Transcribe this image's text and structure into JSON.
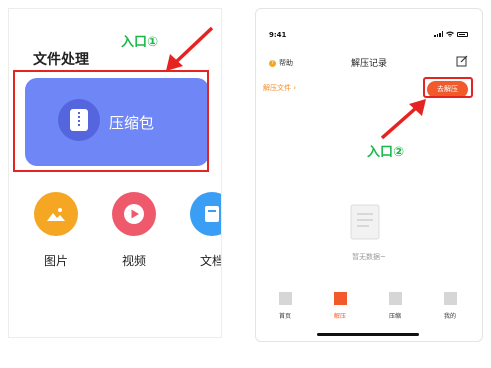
{
  "left": {
    "section_title": "文件处理",
    "annotation": "入口①",
    "compress_label": "压缩包",
    "tools": [
      {
        "label": "图片",
        "icon": "image-icon",
        "color": "#f5a623"
      },
      {
        "label": "视频",
        "icon": "play-icon",
        "color": "#ee5a6c"
      },
      {
        "label": "文档",
        "icon": "document-icon",
        "color": "#3b9ef5"
      }
    ]
  },
  "right": {
    "status_time": "9:41",
    "help_label": "帮助",
    "page_title": "解压记录",
    "extract_files_label": "解压文件 ›",
    "go_extract_label": "去解压",
    "annotation": "入口②",
    "empty_text": "暂无数据~",
    "tabs": [
      {
        "label": "首页",
        "active": false
      },
      {
        "label": "解压",
        "active": true
      },
      {
        "label": "压缩",
        "active": false
      },
      {
        "label": "我的",
        "active": false
      }
    ]
  },
  "colors": {
    "accent_orange": "#f25a2c",
    "card_blue": "#6f86f6",
    "annotation_green": "#19b84a",
    "highlight_red": "#e52320"
  }
}
